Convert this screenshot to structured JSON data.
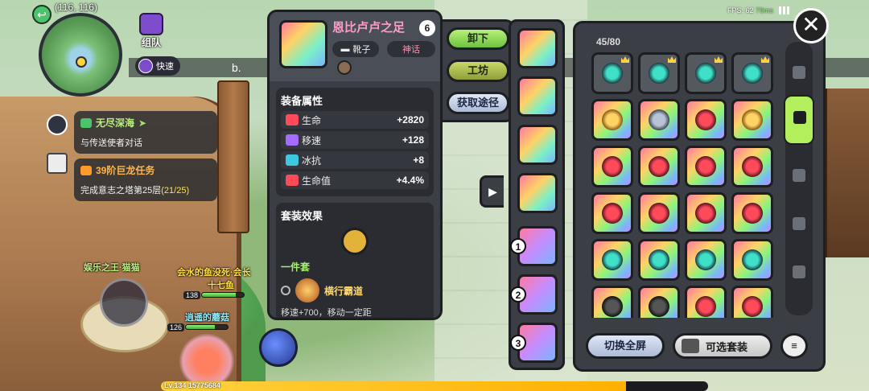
{
  "hud": {
    "coords": "(116, 116)",
    "team_label": "组队",
    "fast_label": "快速",
    "glyph": "b.",
    "fps_label": "FPS: 62",
    "ping": "79ms",
    "close_glyph": "✕"
  },
  "quests": [
    {
      "title": "无尽深海",
      "desc": "与传送使者对话",
      "color": "green"
    },
    {
      "title": "39阶巨龙任务",
      "desc": "完成意志之塔第25层",
      "progress": "(21/25)",
      "color": "orange"
    }
  ],
  "players": {
    "guild_tag": "娱乐之王·猫猫",
    "name_a": "会水的鱼没死·会长",
    "name_b": "十七鱼",
    "name_c": "逍遥的蘑菇",
    "level_a": "138",
    "level_b": "126",
    "hp_a": 0.8,
    "hp_b": 0.7
  },
  "bottom": {
    "level_text": "Lv.134",
    "exp_text": "15775684",
    "exp_fraction": 0.85
  },
  "detail": {
    "item_name": "恩比卢卢之足",
    "level": "6",
    "type": "靴子",
    "rarity": "神话",
    "attr_title": "装备属性",
    "attributes": [
      {
        "name": "生命",
        "value": "+2820",
        "icon": "heart-icon",
        "color": "#ff4a5a"
      },
      {
        "name": "移速",
        "value": "+128",
        "icon": "boot-icon",
        "color": "#a46bff"
      },
      {
        "name": "冰抗",
        "value": "+8",
        "icon": "snowflake-icon",
        "color": "#3ec7e0"
      },
      {
        "name": "生命值",
        "value": "+4.4%",
        "icon": "heart-icon",
        "color": "#ff4a5a"
      }
    ],
    "set_title": "套装效果",
    "set_sub": "一件套",
    "set_effect": "横行霸道",
    "set_desc": "移速+700，移动一定距"
  },
  "actions": {
    "unequip": "卸下",
    "workshop": "工坊",
    "source": "获取途径"
  },
  "equipped_nums": [
    "1",
    "2",
    "3"
  ],
  "inventory": {
    "count": "45/80",
    "cells": [
      {
        "kind": "teal",
        "bg": "dark"
      },
      {
        "kind": "teal",
        "bg": "dark"
      },
      {
        "kind": "teal",
        "bg": "dark"
      },
      {
        "kind": "teal",
        "bg": "dark"
      },
      {
        "kind": "gold",
        "bg": "rainbow"
      },
      {
        "kind": "boot",
        "bg": "rainbow"
      },
      {
        "kind": "red",
        "bg": "rainbow"
      },
      {
        "kind": "gold",
        "bg": "rainbow"
      },
      {
        "kind": "red",
        "bg": "rainbow"
      },
      {
        "kind": "red",
        "bg": "rainbow"
      },
      {
        "kind": "red",
        "bg": "rainbow"
      },
      {
        "kind": "red",
        "bg": "rainbow"
      },
      {
        "kind": "red",
        "bg": "rainbow"
      },
      {
        "kind": "red",
        "bg": "rainbow"
      },
      {
        "kind": "red",
        "bg": "rainbow"
      },
      {
        "kind": "red",
        "bg": "rainbow"
      },
      {
        "kind": "teal",
        "bg": "rainbow"
      },
      {
        "kind": "teal",
        "bg": "rainbow"
      },
      {
        "kind": "teal",
        "bg": "rainbow"
      },
      {
        "kind": "teal",
        "bg": "rainbow"
      },
      {
        "kind": "black",
        "bg": "rainbow"
      },
      {
        "kind": "black",
        "bg": "rainbow"
      },
      {
        "kind": "red",
        "bg": "rainbow"
      },
      {
        "kind": "red",
        "bg": "rainbow"
      }
    ],
    "fullscreen": "切换全屏",
    "optional_set": "可选套装"
  }
}
